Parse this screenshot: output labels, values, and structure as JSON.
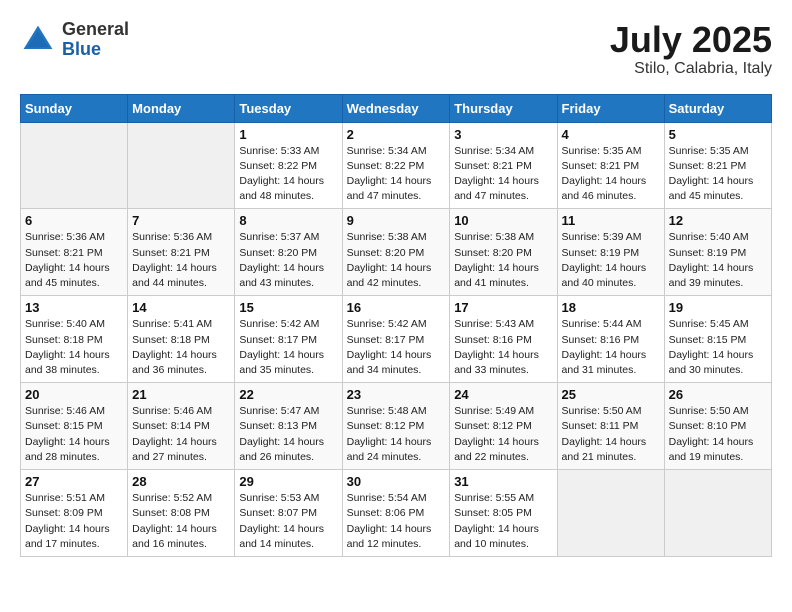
{
  "logo": {
    "general": "General",
    "blue": "Blue"
  },
  "header": {
    "month": "July 2025",
    "location": "Stilo, Calabria, Italy"
  },
  "days_of_week": [
    "Sunday",
    "Monday",
    "Tuesday",
    "Wednesday",
    "Thursday",
    "Friday",
    "Saturday"
  ],
  "weeks": [
    [
      {
        "day": "",
        "sunrise": "",
        "sunset": "",
        "daylight": ""
      },
      {
        "day": "",
        "sunrise": "",
        "sunset": "",
        "daylight": ""
      },
      {
        "day": "1",
        "sunrise": "Sunrise: 5:33 AM",
        "sunset": "Sunset: 8:22 PM",
        "daylight": "Daylight: 14 hours and 48 minutes."
      },
      {
        "day": "2",
        "sunrise": "Sunrise: 5:34 AM",
        "sunset": "Sunset: 8:22 PM",
        "daylight": "Daylight: 14 hours and 47 minutes."
      },
      {
        "day": "3",
        "sunrise": "Sunrise: 5:34 AM",
        "sunset": "Sunset: 8:21 PM",
        "daylight": "Daylight: 14 hours and 47 minutes."
      },
      {
        "day": "4",
        "sunrise": "Sunrise: 5:35 AM",
        "sunset": "Sunset: 8:21 PM",
        "daylight": "Daylight: 14 hours and 46 minutes."
      },
      {
        "day": "5",
        "sunrise": "Sunrise: 5:35 AM",
        "sunset": "Sunset: 8:21 PM",
        "daylight": "Daylight: 14 hours and 45 minutes."
      }
    ],
    [
      {
        "day": "6",
        "sunrise": "Sunrise: 5:36 AM",
        "sunset": "Sunset: 8:21 PM",
        "daylight": "Daylight: 14 hours and 45 minutes."
      },
      {
        "day": "7",
        "sunrise": "Sunrise: 5:36 AM",
        "sunset": "Sunset: 8:21 PM",
        "daylight": "Daylight: 14 hours and 44 minutes."
      },
      {
        "day": "8",
        "sunrise": "Sunrise: 5:37 AM",
        "sunset": "Sunset: 8:20 PM",
        "daylight": "Daylight: 14 hours and 43 minutes."
      },
      {
        "day": "9",
        "sunrise": "Sunrise: 5:38 AM",
        "sunset": "Sunset: 8:20 PM",
        "daylight": "Daylight: 14 hours and 42 minutes."
      },
      {
        "day": "10",
        "sunrise": "Sunrise: 5:38 AM",
        "sunset": "Sunset: 8:20 PM",
        "daylight": "Daylight: 14 hours and 41 minutes."
      },
      {
        "day": "11",
        "sunrise": "Sunrise: 5:39 AM",
        "sunset": "Sunset: 8:19 PM",
        "daylight": "Daylight: 14 hours and 40 minutes."
      },
      {
        "day": "12",
        "sunrise": "Sunrise: 5:40 AM",
        "sunset": "Sunset: 8:19 PM",
        "daylight": "Daylight: 14 hours and 39 minutes."
      }
    ],
    [
      {
        "day": "13",
        "sunrise": "Sunrise: 5:40 AM",
        "sunset": "Sunset: 8:18 PM",
        "daylight": "Daylight: 14 hours and 38 minutes."
      },
      {
        "day": "14",
        "sunrise": "Sunrise: 5:41 AM",
        "sunset": "Sunset: 8:18 PM",
        "daylight": "Daylight: 14 hours and 36 minutes."
      },
      {
        "day": "15",
        "sunrise": "Sunrise: 5:42 AM",
        "sunset": "Sunset: 8:17 PM",
        "daylight": "Daylight: 14 hours and 35 minutes."
      },
      {
        "day": "16",
        "sunrise": "Sunrise: 5:42 AM",
        "sunset": "Sunset: 8:17 PM",
        "daylight": "Daylight: 14 hours and 34 minutes."
      },
      {
        "day": "17",
        "sunrise": "Sunrise: 5:43 AM",
        "sunset": "Sunset: 8:16 PM",
        "daylight": "Daylight: 14 hours and 33 minutes."
      },
      {
        "day": "18",
        "sunrise": "Sunrise: 5:44 AM",
        "sunset": "Sunset: 8:16 PM",
        "daylight": "Daylight: 14 hours and 31 minutes."
      },
      {
        "day": "19",
        "sunrise": "Sunrise: 5:45 AM",
        "sunset": "Sunset: 8:15 PM",
        "daylight": "Daylight: 14 hours and 30 minutes."
      }
    ],
    [
      {
        "day": "20",
        "sunrise": "Sunrise: 5:46 AM",
        "sunset": "Sunset: 8:15 PM",
        "daylight": "Daylight: 14 hours and 28 minutes."
      },
      {
        "day": "21",
        "sunrise": "Sunrise: 5:46 AM",
        "sunset": "Sunset: 8:14 PM",
        "daylight": "Daylight: 14 hours and 27 minutes."
      },
      {
        "day": "22",
        "sunrise": "Sunrise: 5:47 AM",
        "sunset": "Sunset: 8:13 PM",
        "daylight": "Daylight: 14 hours and 26 minutes."
      },
      {
        "day": "23",
        "sunrise": "Sunrise: 5:48 AM",
        "sunset": "Sunset: 8:12 PM",
        "daylight": "Daylight: 14 hours and 24 minutes."
      },
      {
        "day": "24",
        "sunrise": "Sunrise: 5:49 AM",
        "sunset": "Sunset: 8:12 PM",
        "daylight": "Daylight: 14 hours and 22 minutes."
      },
      {
        "day": "25",
        "sunrise": "Sunrise: 5:50 AM",
        "sunset": "Sunset: 8:11 PM",
        "daylight": "Daylight: 14 hours and 21 minutes."
      },
      {
        "day": "26",
        "sunrise": "Sunrise: 5:50 AM",
        "sunset": "Sunset: 8:10 PM",
        "daylight": "Daylight: 14 hours and 19 minutes."
      }
    ],
    [
      {
        "day": "27",
        "sunrise": "Sunrise: 5:51 AM",
        "sunset": "Sunset: 8:09 PM",
        "daylight": "Daylight: 14 hours and 17 minutes."
      },
      {
        "day": "28",
        "sunrise": "Sunrise: 5:52 AM",
        "sunset": "Sunset: 8:08 PM",
        "daylight": "Daylight: 14 hours and 16 minutes."
      },
      {
        "day": "29",
        "sunrise": "Sunrise: 5:53 AM",
        "sunset": "Sunset: 8:07 PM",
        "daylight": "Daylight: 14 hours and 14 minutes."
      },
      {
        "day": "30",
        "sunrise": "Sunrise: 5:54 AM",
        "sunset": "Sunset: 8:06 PM",
        "daylight": "Daylight: 14 hours and 12 minutes."
      },
      {
        "day": "31",
        "sunrise": "Sunrise: 5:55 AM",
        "sunset": "Sunset: 8:05 PM",
        "daylight": "Daylight: 14 hours and 10 minutes."
      },
      {
        "day": "",
        "sunrise": "",
        "sunset": "",
        "daylight": ""
      },
      {
        "day": "",
        "sunrise": "",
        "sunset": "",
        "daylight": ""
      }
    ]
  ]
}
